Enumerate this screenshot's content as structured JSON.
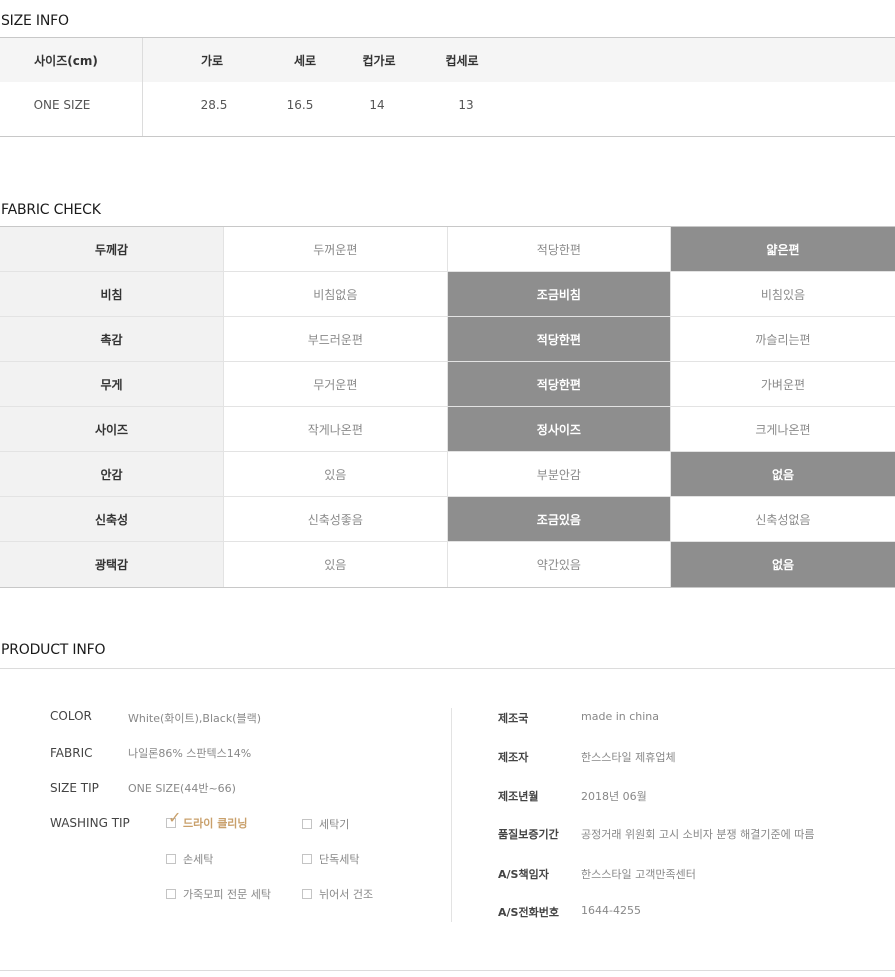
{
  "size_info": {
    "title": "SIZE INFO",
    "headers": [
      "사이즈(cm)",
      "가로",
      "세로",
      "컵가로",
      "컵세로"
    ],
    "row": [
      "ONE SIZE",
      "28.5",
      "16.5",
      "14",
      "13"
    ]
  },
  "fabric_check": {
    "title": "FABRIC CHECK",
    "rows": [
      {
        "label": "두께감",
        "options": [
          "두꺼운편",
          "적당한편",
          "얇은편"
        ],
        "selected": 2
      },
      {
        "label": "비침",
        "options": [
          "비침없음",
          "조금비침",
          "비침있음"
        ],
        "selected": 1
      },
      {
        "label": "촉감",
        "options": [
          "부드러운편",
          "적당한편",
          "까슬리는편"
        ],
        "selected": 1
      },
      {
        "label": "무게",
        "options": [
          "무거운편",
          "적당한편",
          "가벼운편"
        ],
        "selected": 1
      },
      {
        "label": "사이즈",
        "options": [
          "작게나온편",
          "정사이즈",
          "크게나온편"
        ],
        "selected": 1
      },
      {
        "label": "안감",
        "options": [
          "있음",
          "부분안감",
          "없음"
        ],
        "selected": 2
      },
      {
        "label": "신축성",
        "options": [
          "신축성좋음",
          "조금있음",
          "신축성없음"
        ],
        "selected": 1
      },
      {
        "label": "광택감",
        "options": [
          "있음",
          "약간있음",
          "없음"
        ],
        "selected": 2
      }
    ]
  },
  "product_info": {
    "title": "PRODUCT INFO",
    "color_label": "COLOR",
    "color_value": "White(화이트),Black(블랙)",
    "fabric_label": "FABRIC",
    "fabric_value": "나일론86% 스판텍스14%",
    "size_tip_label": "SIZE TIP",
    "size_tip_value": "ONE SIZE(44반~66)",
    "washing_label": "WASHING TIP",
    "washing": [
      {
        "label": "드라이 클리닝",
        "checked": true
      },
      {
        "label": "세탁기",
        "checked": false
      },
      {
        "label": "손세탁",
        "checked": false
      },
      {
        "label": "단독세탁",
        "checked": false
      },
      {
        "label": "가죽모피 전문 세탁",
        "checked": false
      },
      {
        "label": "뉘어서 건조",
        "checked": false
      }
    ],
    "details": [
      {
        "label": "제조국",
        "value": "made in china"
      },
      {
        "label": "제조자",
        "value": "한스스타일 제휴업체"
      },
      {
        "label": "제조년월",
        "value": "2018년 06월"
      },
      {
        "label": "품질보증기간",
        "value": "공정거래 위원회 고시 소비자 분쟁 해결기준에 따름"
      },
      {
        "label": "A/S책임자",
        "value": "한스스타일 고객만족센터"
      },
      {
        "label": "A/S전화번호",
        "value": "1644-4255"
      }
    ]
  }
}
